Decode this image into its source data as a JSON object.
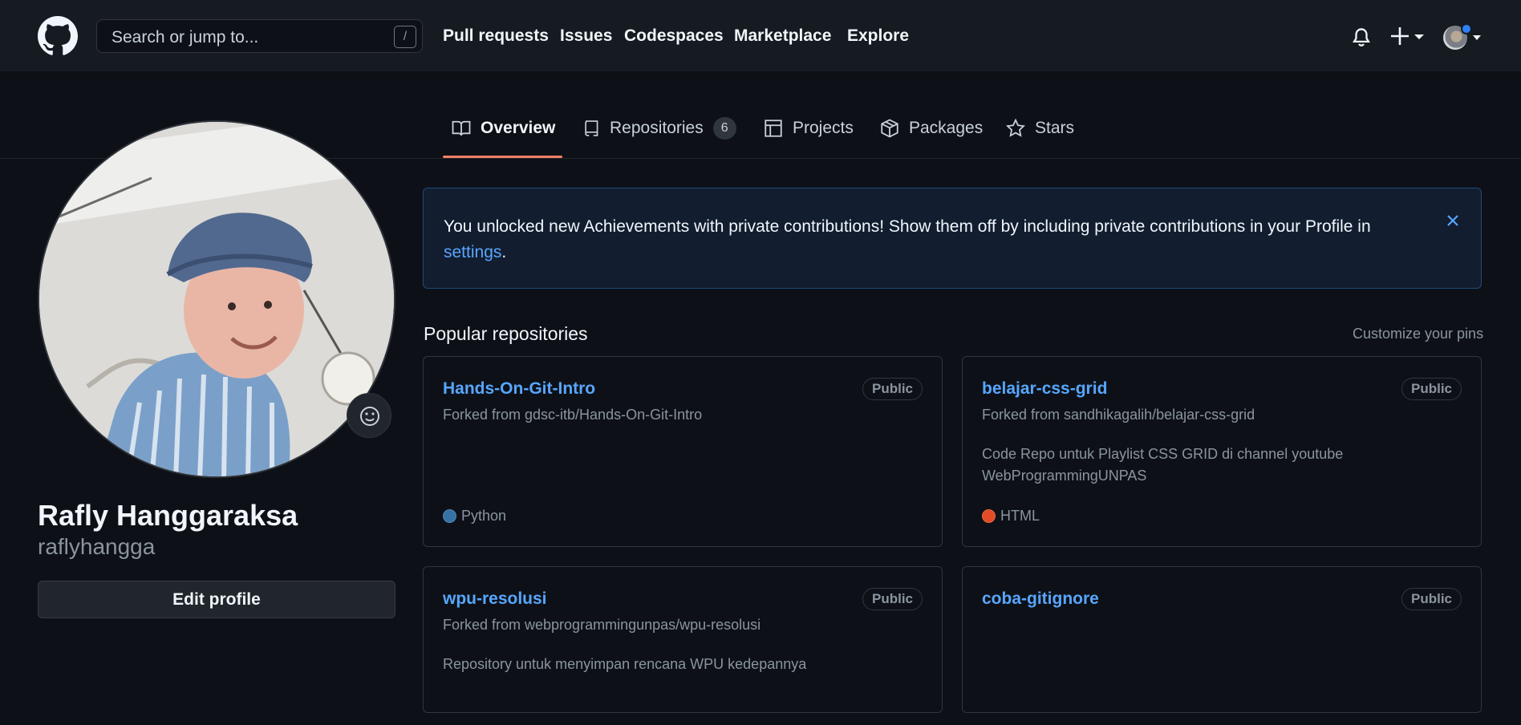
{
  "header": {
    "search_placeholder": "Search or jump to...",
    "search_shortcut": "/",
    "nav": [
      "Pull requests",
      "Issues",
      "Codespaces",
      "Marketplace",
      "Explore"
    ],
    "icons": [
      "github-logo",
      "bell-icon",
      "plus-icon",
      "avatar"
    ]
  },
  "tabs": {
    "overview": "Overview",
    "repositories": "Repositories",
    "repositories_count": "6",
    "projects": "Projects",
    "packages": "Packages",
    "stars": "Stars"
  },
  "profile": {
    "name": "Rafly Hanggaraksa",
    "login": "raflyhangga",
    "edit_button": "Edit profile"
  },
  "flash": {
    "message": "You unlocked new Achievements with private contributions! Show them off by including private contributions in your Profile in ",
    "link": "settings",
    "suffix": "."
  },
  "popular": {
    "title": "Popular repositories",
    "customize": "Customize your pins",
    "repos": [
      {
        "name": "Hands-On-Git-Intro",
        "visibility": "Public",
        "fork": "Forked from gdsc-itb/Hands-On-Git-Intro",
        "description": "",
        "language": "Python",
        "language_color": "#3572A5"
      },
      {
        "name": "belajar-css-grid",
        "visibility": "Public",
        "fork": "Forked from sandhikagalih/belajar-css-grid",
        "description": "Code Repo untuk Playlist CSS GRID di channel youtube WebProgrammingUNPAS",
        "language": "HTML",
        "language_color": "#e34c26"
      },
      {
        "name": "wpu-resolusi",
        "visibility": "Public",
        "fork": "Forked from webprogrammingunpas/wpu-resolusi",
        "description": "Repository untuk menyimpan rencana WPU kedepannya",
        "language": "",
        "language_color": ""
      },
      {
        "name": "coba-gitignore",
        "visibility": "Public",
        "fork": "",
        "description": "",
        "language": "",
        "language_color": ""
      }
    ]
  },
  "colors": {
    "accent": "#58a6ff",
    "tab_underline": "#f78166",
    "bg": "#0d1117",
    "header_bg": "#161b22"
  }
}
